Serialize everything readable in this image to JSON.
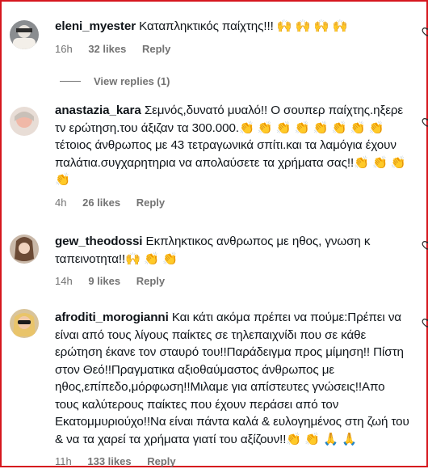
{
  "comments": [
    {
      "username": "eleni_myester",
      "text": "Καταπληκτικός παίχτης!!! 🙌 🙌 🙌 🙌",
      "time": "16h",
      "likes": "32 likes",
      "reply": "Reply",
      "view_replies": "View replies (1)"
    },
    {
      "username": "anastazia_kara",
      "text": "Σεμνός,δυνατό μυαλό!! Ο σουπερ παίχτης.ηξερε τν ερώτηση.του άξιζαν τα 300.000.👏 👏 👏 👏 👏 👏 👏 👏 τέτοιος άνθρωπος με 43 τετραγωνικά σπίτι.και τα λαμόγια έχουν παλάτια.συγχαρητηρια να απολαύσετε τα χρήματα σας!!👏 👏 👏 👏",
      "time": "4h",
      "likes": "26 likes",
      "reply": "Reply"
    },
    {
      "username": "gew_theodossi",
      "text": "Εκπληκτικος ανθρωπος με ηθος, γνωση κ ταπεινοτητα!!🙌 👏 👏",
      "time": "14h",
      "likes": "9 likes",
      "reply": "Reply"
    },
    {
      "username": "afroditi_morogianni",
      "text": "Και κάτι ακόμα πρέπει να πούμε:Πρέπει να είναι από τους λίγους παίκτες σε τηλεπαιχνίδι που σε κάθε ερώτηση έκανε τον σταυρό του!!Παράδειγμα προς μίμηση!! Πίστη στον Θεό!!Πραγματικα αξιοθαύμαστος άνθρωπος με ηθος,επίπεδο,μόρφωση!!Μιλαμε για απίστευτες γνώσεις!!Απο τους καλύτερους παίκτες που έχουν περάσει από τον Εκατομμυριούχο!!Να είναι πάντα καλά & ευλογημένος στη ζωή του & να τα χαρεί τα χρήματα γιατί του αξίζουν!!👏 👏 🙏 🙏",
      "time": "11h",
      "likes": "133 likes",
      "reply": "Reply"
    }
  ],
  "colors": {
    "border": "#d6161e",
    "muted": "#737373",
    "text": "#0f1419"
  },
  "icons": [
    "heart-outline-icon",
    "avatar-photo"
  ]
}
